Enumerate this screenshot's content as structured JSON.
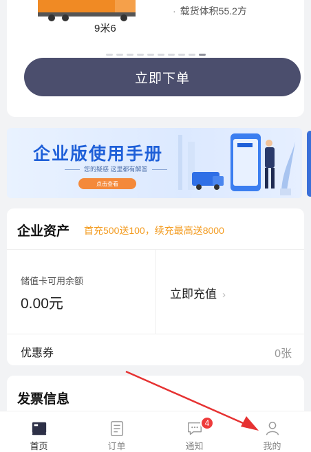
{
  "vehicle": {
    "name": "9米6",
    "spec": "载货体积55.2方",
    "pager_count": 10,
    "pager_active_index": 9
  },
  "order_button": {
    "label": "立即下单"
  },
  "banner": {
    "title": "企业版使用手册",
    "subtitle": "您的疑惑 这里都有解答",
    "button_label": "点击查看"
  },
  "assets": {
    "title": "企业资产",
    "promo": "首充500送100，续充最高送8000",
    "balance_label": "储值卡可用余额",
    "balance_value": "0.00元",
    "recharge_label": "立即充值",
    "coupon_label": "优惠券",
    "coupon_value": "0张"
  },
  "invoice": {
    "title": "发票信息"
  },
  "tabbar": {
    "items": [
      {
        "label": "首页",
        "icon": "home-icon",
        "active": true
      },
      {
        "label": "订单",
        "icon": "orders-icon",
        "active": false
      },
      {
        "label": "通知",
        "icon": "message-icon",
        "active": false,
        "badge": "4"
      },
      {
        "label": "我的",
        "icon": "profile-icon",
        "active": false
      }
    ]
  },
  "colors": {
    "primary_button": "#4b4e6d",
    "promo_orange": "#f39a1d",
    "badge_red": "#ee3b3b",
    "banner_blue": "#1e5fd8",
    "arrow_red": "#e63232"
  }
}
